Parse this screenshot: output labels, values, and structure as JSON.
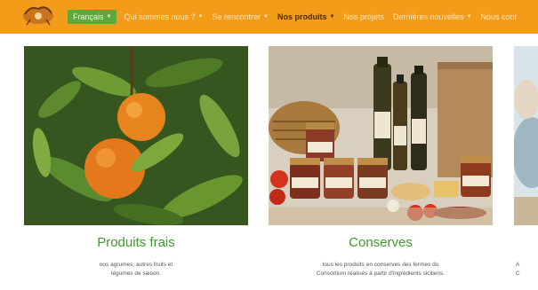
{
  "nav": {
    "language": "Français",
    "links": [
      {
        "label": "Qui sommes nous ?",
        "dropdown": true,
        "active": false
      },
      {
        "label": "Se rencontrer",
        "dropdown": true,
        "active": false
      },
      {
        "label": "Nos produits",
        "dropdown": true,
        "active": true
      },
      {
        "label": "Nos projets",
        "dropdown": false,
        "active": false
      },
      {
        "label": "Dernières nouvelles",
        "dropdown": true,
        "active": false
      },
      {
        "label": "Nous cont",
        "dropdown": false,
        "active": false
      }
    ]
  },
  "cards": [
    {
      "title": "Produits frais",
      "desc_line1": "nos agrumes, autres fruits et",
      "desc_line2": "légumes de saison."
    },
    {
      "title": "Conserves",
      "desc_line1": "tous les produits en conserves des fermes du",
      "desc_line2": "Consortium réalisés à partir d'ingrédients siciliens."
    },
    {
      "title": "",
      "desc_line1": "A",
      "desc_line2": "C"
    }
  ],
  "colors": {
    "navbar": "#f39c1a",
    "language_button": "#5fa83a",
    "card_title": "#3e9b2c"
  },
  "icons": [
    "logo-icon",
    "caret-down-icon"
  ]
}
